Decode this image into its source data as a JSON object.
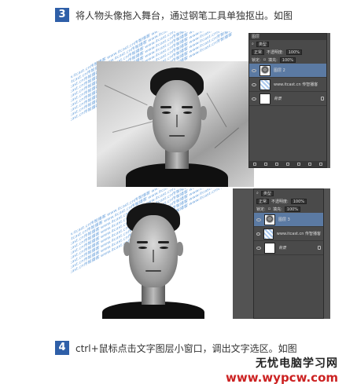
{
  "steps": [
    {
      "number": "3",
      "text": "将人物头像拖入舞台，通过钢笔工具单独抠出。如图"
    },
    {
      "number": "4",
      "text": "ctrl+鼠标点击文字图层小窗口，调出文字选区。如图"
    }
  ],
  "layers_panel_1": {
    "tab": "图层",
    "kind_select": "类型",
    "blend_mode": "正常",
    "opacity_label": "不透明度:",
    "opacity_value": "100%",
    "lock_label": "锁定:",
    "fill_label": "填充:",
    "fill_value": "100%",
    "layers": [
      {
        "name": "图层 2",
        "thumb": "person",
        "selected": true
      },
      {
        "name": "www.itcast.cn 传智播客",
        "thumb": "text",
        "selected": false
      },
      {
        "name": "背景",
        "thumb": "white",
        "selected": false,
        "locked": true
      }
    ]
  },
  "layers_panel_2": {
    "kind_select": "类型",
    "blend_mode": "正常",
    "opacity_label": "不透明度:",
    "opacity_value": "100%",
    "lock_label": "锁定:",
    "fill_label": "填充:",
    "fill_value": "100%",
    "layers": [
      {
        "name": "图层 3",
        "thumb": "person",
        "selected": true
      },
      {
        "name": "www.itcast.cn 传智播客",
        "thumb": "text",
        "selected": false
      },
      {
        "name": "背景",
        "thumb": "white",
        "selected": false,
        "locked": true
      }
    ]
  },
  "watermark": {
    "title": "无忧电脑学习网",
    "url": "www.wypcw.com"
  }
}
